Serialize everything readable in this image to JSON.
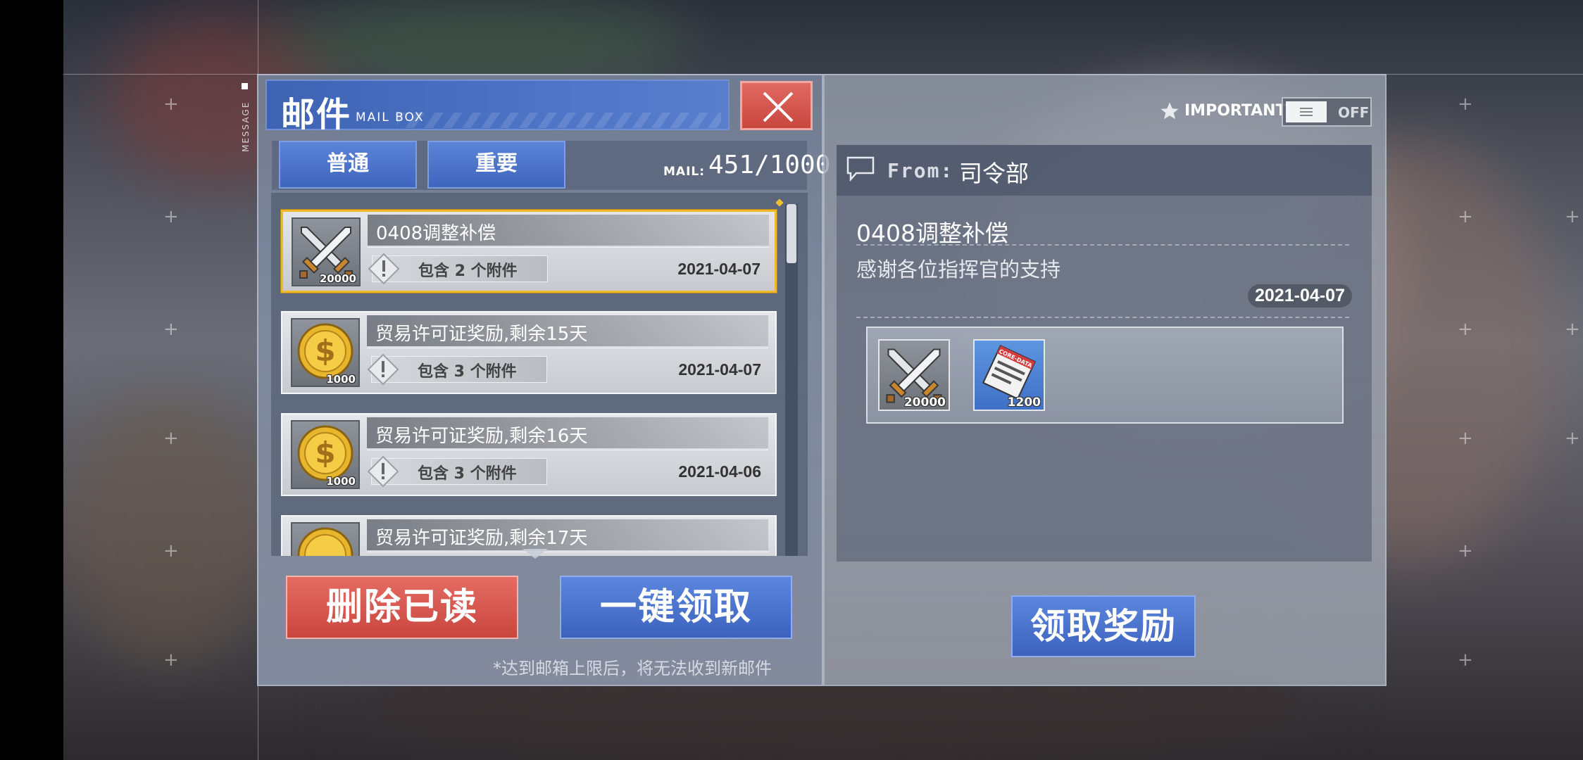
{
  "side_label": "MESSAGE",
  "header": {
    "title": "邮件",
    "subtitle": "MAIL BOX"
  },
  "tabs": [
    {
      "label": "普通"
    },
    {
      "label": "重要"
    }
  ],
  "mail_count": {
    "label": "MAIL:",
    "value": "451/1000"
  },
  "mails": [
    {
      "subject": "0408调整补偿",
      "attachments": "包含 2 个附件",
      "date": "2021-04-07",
      "item_qty": "20000",
      "icon": "crossed-swords-icon",
      "selected": true
    },
    {
      "subject": "贸易许可证奖励,剩余15天",
      "attachments": "包含 3 个附件",
      "date": "2021-04-07",
      "item_qty": "1000",
      "icon": "gold-coin-icon"
    },
    {
      "subject": "贸易许可证奖励,剩余16天",
      "attachments": "包含 3 个附件",
      "date": "2021-04-06",
      "item_qty": "1000",
      "icon": "gold-coin-icon"
    },
    {
      "subject": "贸易许可证奖励,剩余17天",
      "icon": "gold-coin-icon"
    }
  ],
  "buttons": {
    "delete_read": "删除已读",
    "claim_all": "一键领取",
    "claim_reward": "领取奖励"
  },
  "note": "*达到邮箱上限后，将无法收到新邮件",
  "important_filter": {
    "label": "IMPORTANT",
    "state": "OFF"
  },
  "detail": {
    "from_label": "From:",
    "sender": "司令部",
    "subject": "0408调整补偿",
    "body": "感谢各位指挥官的支持",
    "date": "2021-04-07",
    "attachments": [
      {
        "icon": "crossed-swords-icon",
        "qty": "20000"
      },
      {
        "icon": "core-data-icon",
        "label": "CORE-DATA",
        "qty": "1200"
      }
    ]
  },
  "colors": {
    "accent_blue": "#4d74c6",
    "danger_red": "#c9473f",
    "selected_gold": "#f0b92c"
  }
}
